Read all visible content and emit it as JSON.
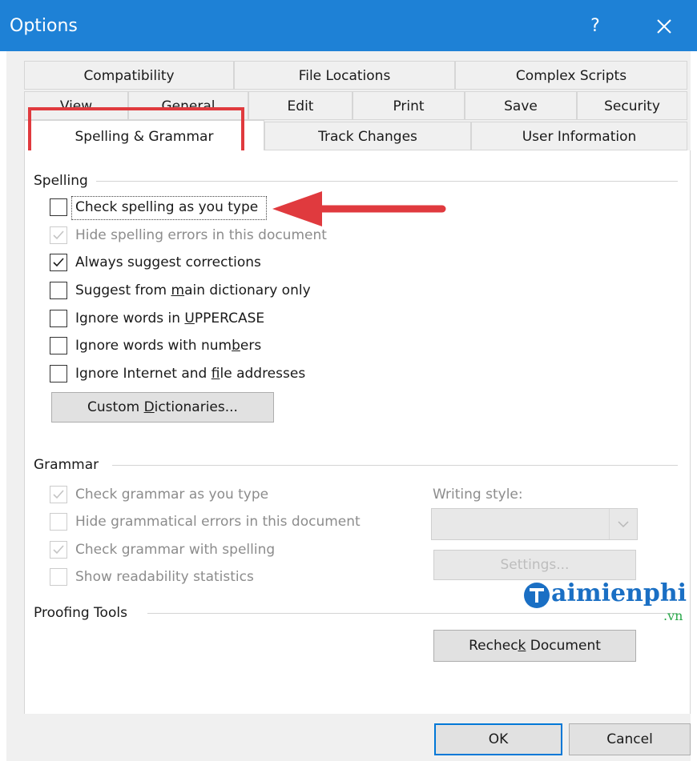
{
  "window": {
    "title": "Options",
    "help_label": "?"
  },
  "tabs": {
    "row1": [
      "Compatibility",
      "File Locations",
      "Complex Scripts"
    ],
    "row2": [
      "View",
      "General",
      "Edit",
      "Print",
      "Save",
      "Security"
    ],
    "row3": [
      "Spelling & Grammar",
      "Track Changes",
      "User Information"
    ]
  },
  "spelling": {
    "title": "Spelling",
    "check_spelling": {
      "label": "Check spelling as you type",
      "checked": false
    },
    "hide_spelling": {
      "label": "Hide spelling errors in this document",
      "checked": true,
      "disabled": true
    },
    "always_suggest": {
      "label": "Always suggest corrections",
      "checked": true
    },
    "main_dictionary": {
      "pre": "Suggest from ",
      "accel": "m",
      "post": "ain dictionary only",
      "checked": false
    },
    "ignore_uppercase": {
      "pre": "Ignore words in ",
      "accel": "U",
      "post": "PPERCASE",
      "checked": false
    },
    "ignore_numbers": {
      "pre": "Ignore words with num",
      "accel": "b",
      "post": "ers",
      "checked": false
    },
    "ignore_internet": {
      "pre": "Ignore Internet and ",
      "accel": "f",
      "post": "ile addresses",
      "checked": false
    },
    "custom_dictionaries": {
      "pre": "Custom ",
      "accel": "D",
      "post": "ictionaries..."
    }
  },
  "grammar": {
    "title": "Grammar",
    "check_grammar": {
      "label": "Check grammar as you type",
      "checked": true
    },
    "hide_grammar": {
      "label": "Hide grammatical errors in this document",
      "checked": false
    },
    "with_spelling": {
      "label": "Check grammar with spelling",
      "checked": true
    },
    "readability": {
      "label": "Show readability statistics",
      "checked": false
    },
    "writing_style_label": "Writing style:",
    "writing_style_value": "",
    "settings_label": "Settings..."
  },
  "proofing": {
    "title": "Proofing Tools",
    "recheck": {
      "pre": "Rechec",
      "accel": "k",
      "post": " Document"
    }
  },
  "footer": {
    "ok_label": "OK",
    "cancel_label": "Cancel"
  },
  "watermark": {
    "name": "aimienphi",
    "tld": ".vn"
  },
  "colors": {
    "titlebar": "#1e81d6",
    "annotation_red": "#e03a3e",
    "watermark_blue": "#1a6fc4",
    "watermark_green": "#2aa84a"
  }
}
